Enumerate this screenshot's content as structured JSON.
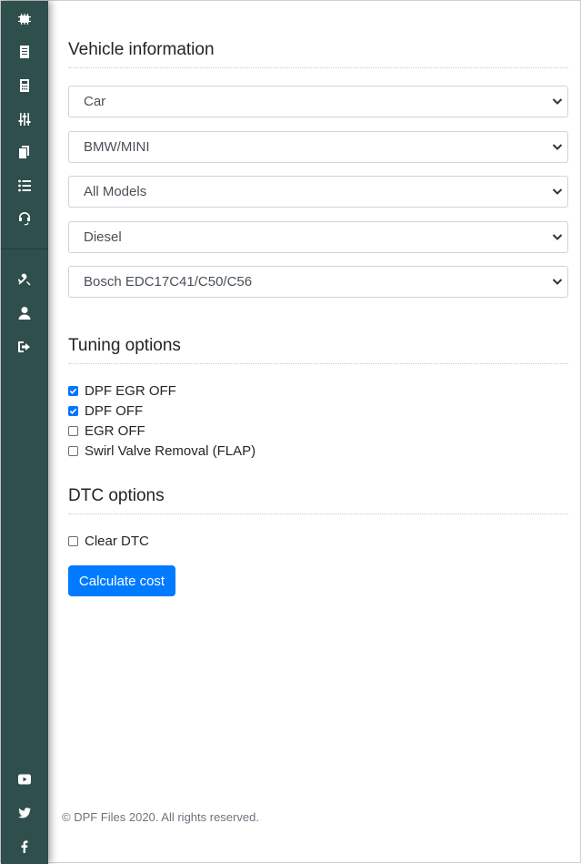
{
  "sidebar": {
    "top_items": [
      {
        "icon": "chip-icon"
      },
      {
        "icon": "document-icon"
      },
      {
        "icon": "calculator-icon"
      },
      {
        "icon": "sliders-icon"
      },
      {
        "icon": "files-icon"
      },
      {
        "icon": "list-icon"
      },
      {
        "icon": "headset-icon"
      }
    ],
    "middle_items": [
      {
        "icon": "tools-icon"
      },
      {
        "icon": "user-icon"
      },
      {
        "icon": "logout-icon"
      }
    ],
    "social_items": [
      {
        "icon": "youtube-icon"
      },
      {
        "icon": "twitter-icon"
      },
      {
        "icon": "facebook-icon"
      }
    ],
    "color": "#2f4f4c"
  },
  "vehicle": {
    "title": "Vehicle information",
    "selects": [
      "Car",
      "BMW/MINI",
      "All Models",
      "Diesel",
      "Bosch EDC17C41/C50/C56"
    ]
  },
  "tuning": {
    "title": "Tuning options",
    "options": [
      {
        "label": "DPF EGR OFF",
        "checked": true
      },
      {
        "label": "DPF OFF",
        "checked": true
      },
      {
        "label": "EGR OFF",
        "checked": false
      },
      {
        "label": "Swirl Valve Removal (FLAP)",
        "checked": false
      }
    ]
  },
  "dtc": {
    "title": "DTC options",
    "options": [
      {
        "label": "Clear DTC",
        "checked": false
      }
    ]
  },
  "button": {
    "label": "Calculate cost",
    "color": "#007bff"
  },
  "footer": {
    "text": "© DPF Files 2020. All rights reserved."
  }
}
